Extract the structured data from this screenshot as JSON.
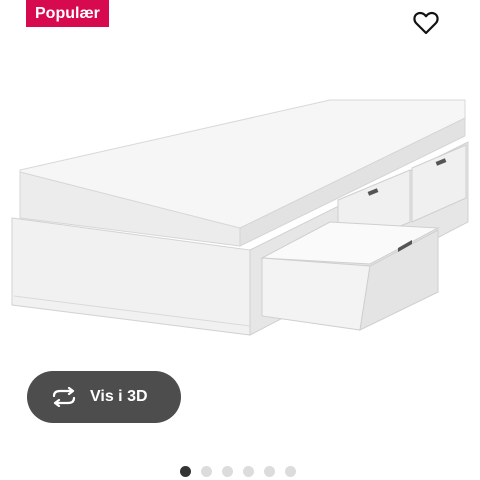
{
  "badge": {
    "label": "Populær",
    "color": "#d70a4f"
  },
  "favorite": {
    "icon": "heart-outline-icon"
  },
  "product": {
    "image_description": "white storage bed with mattress and drawers"
  },
  "view_3d": {
    "label": "Vis i 3D",
    "icon": "rotate-3d-icon"
  },
  "carousel": {
    "count": 6,
    "active_index": 0
  }
}
